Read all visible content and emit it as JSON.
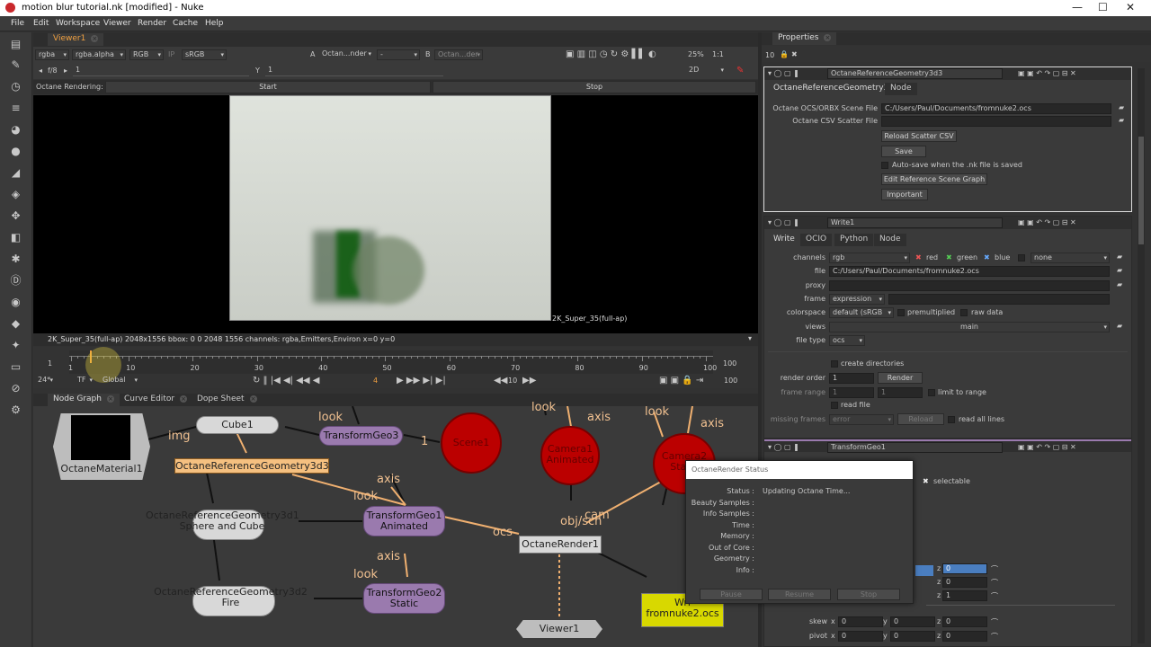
{
  "window": {
    "title": "motion blur tutorial.nk [modified] - Nuke",
    "minimize": "—",
    "maximize": "☐",
    "close": "✕"
  },
  "menu": [
    "File",
    "Edit",
    "Workspace",
    "Viewer",
    "Render",
    "Cache",
    "Help"
  ],
  "viewer": {
    "tab": "Viewer1",
    "channels": "rgba",
    "alpha": "rgba.alpha",
    "colorspace_mode": "RGB",
    "ip": "IP",
    "display": "sRGB",
    "a_label": "A",
    "a_input": "Octan...nder",
    "a_blend": "-",
    "b_label": "B",
    "b_input": "Octan...der",
    "zoom_pct": "25%",
    "ratio": "1:1",
    "fstop": "f/8",
    "frame_field": "1",
    "y_label": "Y",
    "y_value": "1",
    "view_mode": "2D",
    "octane_label": "Octane Rendering:",
    "start": "Start",
    "stop": "Stop",
    "format_label": "2K_Super_35(full-ap)",
    "info_line": "2K_Super_35(full-ap) 2048x1556  bbox: 0 0 2048 1556 channels: rgba,Emitters,Environ  x=0 y=0"
  },
  "timeline": {
    "start": "1",
    "end": "100",
    "ticks": [
      "1",
      "10",
      "20",
      "30",
      "40",
      "50",
      "60",
      "70",
      "80",
      "90",
      "100"
    ],
    "current_frame": 4,
    "fps": "24*",
    "tf": "TF",
    "scope": "Global",
    "frame": "4",
    "step": "10",
    "end_frame": "100"
  },
  "ng_tabs": [
    "Node Graph",
    "Curve Editor",
    "Dope Sheet"
  ],
  "nodes": {
    "octane_material": "OctaneMaterial1",
    "cube": "Cube1",
    "ref_geo3": "OctaneReferenceGeometry3d3",
    "transform_geo3": "TransformGeo3",
    "scene": "Scene1",
    "camera1": "Camera1\nAnimated",
    "camera2": "Camera2\nStatic",
    "ref_geo1_a": "OctaneReferenceGeometry3d1",
    "ref_geo1_b": "Sphere and Cube",
    "transform_geo1_a": "TransformGeo1",
    "transform_geo1_b": "Animated",
    "octane_render": "OctaneRender1",
    "ref_geo2_a": "OctaneReferenceGeometry3d2",
    "ref_geo2_b": "Fire",
    "transform_geo2_a": "TransformGeo2",
    "transform_geo2_b": "Static",
    "viewer": "Viewer1",
    "write_a": "Wri",
    "write_b": "fromnuke2.ocs"
  },
  "edge_labels": {
    "img": "img",
    "look1": "look",
    "one": "1",
    "look2": "look",
    "axis1": "axis",
    "look3": "look",
    "axis2": "axis",
    "look4": "look",
    "axis3": "axis",
    "look5": "look",
    "axis4": "axis",
    "cam": "cam",
    "objscn": "obj/scn",
    "ocs": "ocs"
  },
  "properties": {
    "tab": "Properties",
    "count": "10",
    "ref_panel": {
      "name": "OctaneReferenceGeometry3d3",
      "tabs": [
        "OctaneReferenceGeometry3d",
        "Node"
      ],
      "scene_file_label": "Octane OCS/ORBX Scene File",
      "scene_file": "C:/Users/Paul/Documents/fromnuke2.ocs",
      "csv_label": "Octane CSV Scatter File",
      "csv_value": "",
      "reload_csv": "Reload Scatter CSV",
      "save": "Save",
      "autosave": "Auto-save when the .nk file is saved",
      "edit_graph": "Edit Reference Scene Graph",
      "important": "Important"
    },
    "write_panel": {
      "name": "Write1",
      "tabs": [
        "Write",
        "OCIO",
        "Python",
        "Node"
      ],
      "channels_label": "channels",
      "channels": "rgb",
      "red": "red",
      "green": "green",
      "blue": "blue",
      "alpha": "none",
      "file_label": "file",
      "file": "C:/Users/Paul/Documents/fromnuke2.ocs",
      "proxy_label": "proxy",
      "frame_label": "frame",
      "frame": "expression",
      "colorspace_label": "colorspace",
      "colorspace": "default (sRGB",
      "premultiplied": "premultiplied",
      "raw_data": "raw data",
      "views_label": "views",
      "views": "main",
      "file_type_label": "file type",
      "file_type": "ocs",
      "create_dirs": "create directories",
      "render_order_label": "render order",
      "render_order": "1",
      "render": "Render",
      "frame_range_label": "frame range",
      "frame_range_a": "1",
      "frame_range_b": "1",
      "limit_range": "limit to range",
      "read_file": "read file",
      "missing_label": "missing frames",
      "missing": "error",
      "reload": "Reload",
      "read_all": "read all lines"
    },
    "transform_panel": {
      "name": "TransformGeo1",
      "selectable": "selectable",
      "z_label": "z",
      "z1": "0",
      "z2": "0",
      "z3": "1",
      "skew_label": "skew",
      "pivot_label": "pivot",
      "x_label": "x",
      "y_label": "y",
      "skew": [
        "0",
        "0",
        "0"
      ],
      "pivot": [
        "0",
        "0",
        "0"
      ]
    }
  },
  "status_dialog": {
    "title": "OctaneRender Status",
    "rows": [
      {
        "label": "Status :",
        "value": "Updating Octane Time..."
      },
      {
        "label": "Beauty Samples :",
        "value": ""
      },
      {
        "label": "Info Samples :",
        "value": ""
      },
      {
        "label": "Time :",
        "value": ""
      },
      {
        "label": "Memory :",
        "value": ""
      },
      {
        "label": "Out of Core :",
        "value": ""
      },
      {
        "label": "Geometry :",
        "value": ""
      },
      {
        "label": "Info :",
        "value": ""
      }
    ],
    "pause": "Pause",
    "resume": "Resume",
    "stop": "Stop"
  },
  "colors": {
    "accent": "#f0a040",
    "node_selected": "#f5c080",
    "red": "#b00000",
    "purple": "#9a7aae",
    "write_yellow": "#d8d800"
  }
}
